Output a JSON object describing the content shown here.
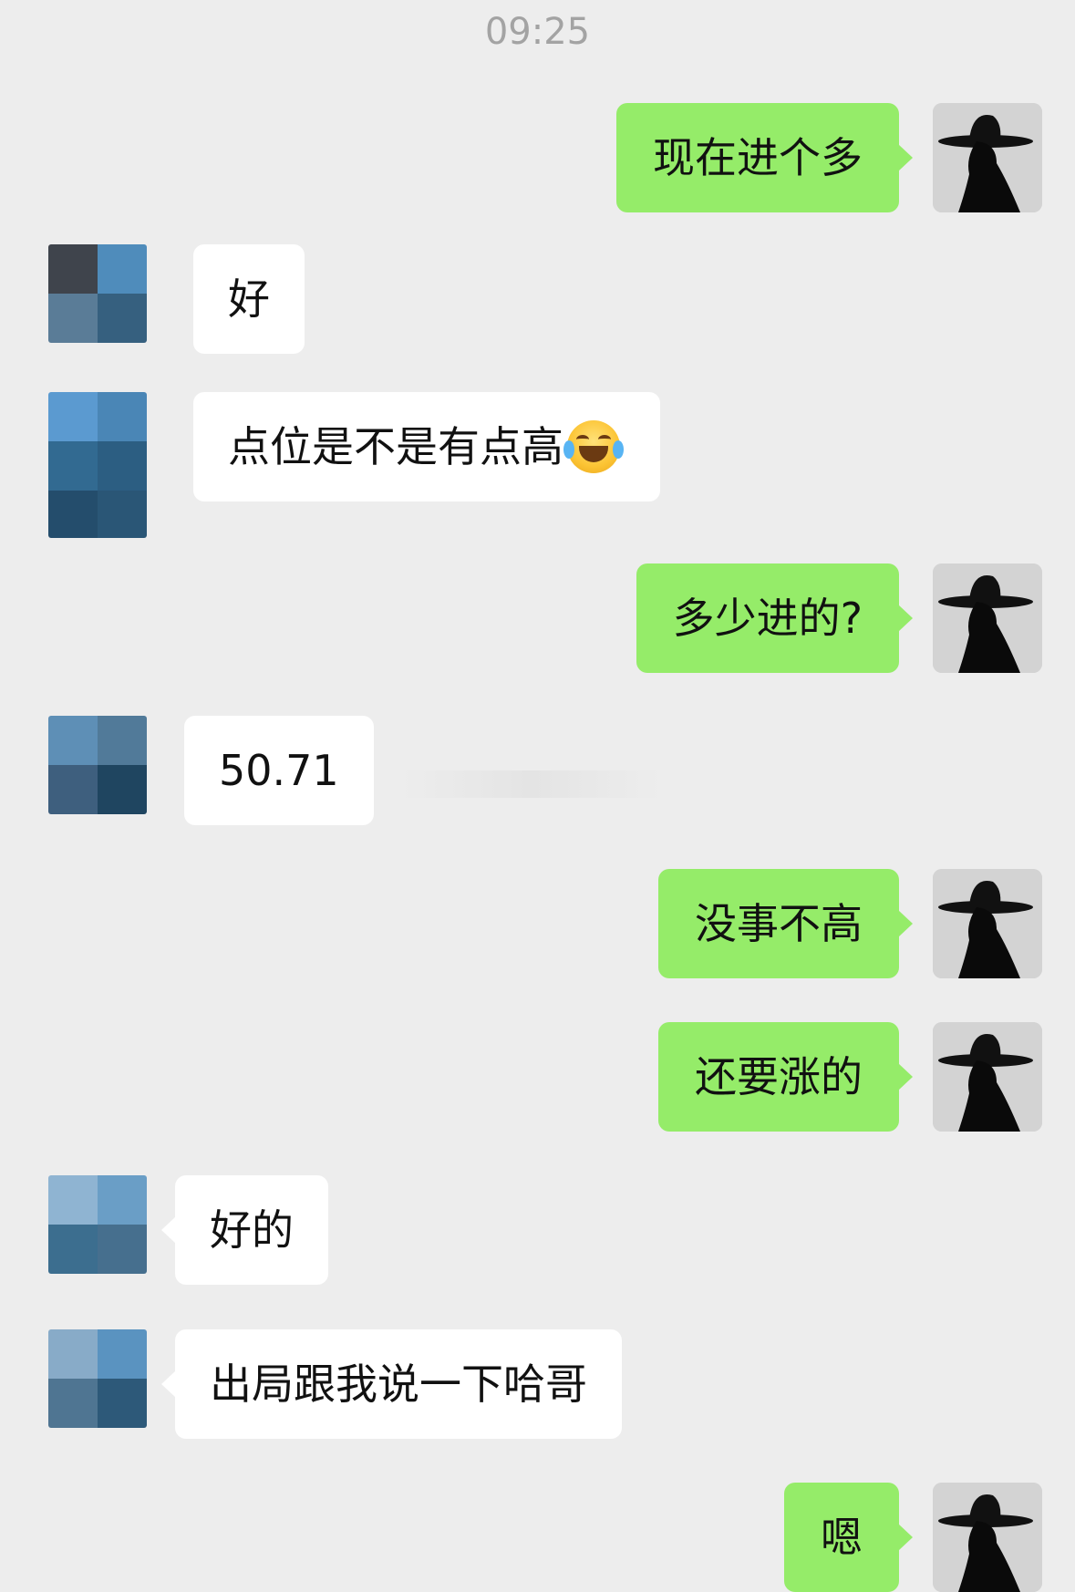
{
  "header": {
    "time": "09:25"
  },
  "messages": [
    {
      "from": "me",
      "text": "现在进个多"
    },
    {
      "from": "other",
      "text": "好"
    },
    {
      "from": "other",
      "text": "点位是不是有点高",
      "emoji": "tears-of-joy-emoji"
    },
    {
      "from": "me",
      "text": "多少进的?"
    },
    {
      "from": "other",
      "text": "50.71"
    },
    {
      "from": "me",
      "text": "没事不高"
    },
    {
      "from": "me",
      "text": "还要涨的"
    },
    {
      "from": "other",
      "text": "好的"
    },
    {
      "from": "other",
      "text": "出局跟我说一下哈哥"
    },
    {
      "from": "me",
      "text": "嗯"
    }
  ],
  "colors": {
    "background": "#ededed",
    "my_bubble": "#95ec69",
    "their_bubble": "#ffffff",
    "timestamp": "#a3a3a3"
  }
}
